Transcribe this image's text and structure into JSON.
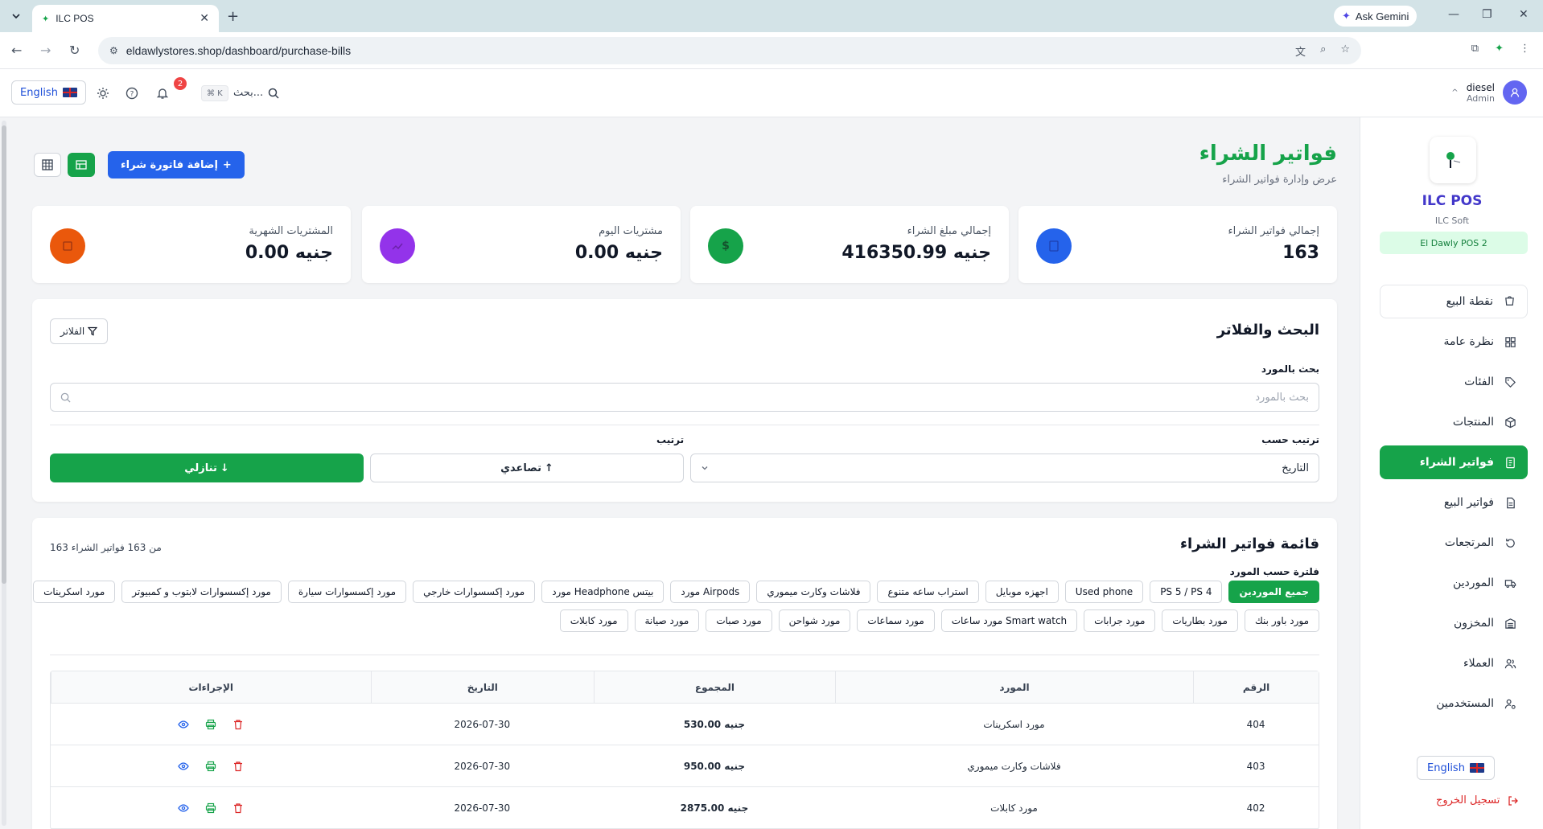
{
  "browser": {
    "tab_title": "ILC POS",
    "url": "eldawlystores.shop/dashboard/purchase-bills",
    "gemini_label": "Ask Gemini"
  },
  "header": {
    "lang_label": "English",
    "notif_count": "2",
    "kbd_hint": "⌘ K",
    "search_label": "بحث...",
    "user_name": "diesel",
    "user_role": "Admin"
  },
  "sidebar": {
    "brand": "ILC POS",
    "brand_sub": "ILC Soft",
    "badge": "El Dawly POS 2",
    "items": [
      {
        "label": "نقطة البيع",
        "icon": "cart-icon"
      },
      {
        "label": "نظرة عامة",
        "icon": "dashboard-icon"
      },
      {
        "label": "الفئات",
        "icon": "tag-icon"
      },
      {
        "label": "المنتجات",
        "icon": "box-icon"
      },
      {
        "label": "فواتير الشراء",
        "icon": "receipt-icon"
      },
      {
        "label": "فواتير البيع",
        "icon": "file-icon"
      },
      {
        "label": "المرتجعات",
        "icon": "rotate-icon"
      },
      {
        "label": "الموردين",
        "icon": "truck-icon"
      },
      {
        "label": "المخزون",
        "icon": "warehouse-icon"
      },
      {
        "label": "العملاء",
        "icon": "users-icon"
      },
      {
        "label": "المستخدمين",
        "icon": "user-cog-icon"
      }
    ],
    "lang_label": "English",
    "logout_label": "تسجيل الخروج"
  },
  "page": {
    "title": "فواتير الشراء",
    "subtitle": "عرض وإدارة فواتير الشراء",
    "add_button": "إضافة فاتورة شراء"
  },
  "stats": [
    {
      "label": "إجمالي فواتير الشراء",
      "value": "163",
      "color": "#2563eb"
    },
    {
      "label": "إجمالي مبلغ الشراء",
      "value": "416350.99 جنيه",
      "color": "#16a34a"
    },
    {
      "label": "مشتريات اليوم",
      "value": "0.00 جنيه",
      "color": "#9333ea"
    },
    {
      "label": "المشتريات الشهرية",
      "value": "0.00 جنيه",
      "color": "#ea580c"
    }
  ],
  "filters": {
    "title": "البحث والفلاتر",
    "filters_button": "الفلاتر",
    "supplier_label": "بحث بالمورد",
    "supplier_placeholder": "بحث بالمورد",
    "sort_by_label": "ترتيب حسب",
    "sort_by_value": "التاريخ",
    "order_label": "ترتيب",
    "asc_label": "تصاعدي",
    "desc_label": "تنازلي"
  },
  "list": {
    "title": "قائمة فواتير الشراء",
    "count_text": "163 من 163 فواتير الشراء",
    "filter_label": "فلترة حسب المورد",
    "chips_row1": [
      "جميع الموردين",
      "PS 5 / PS 4",
      "Used phone",
      "اجهزه موبايل",
      "استراب ساعه متنوع",
      "فلاشات وكارت ميموري",
      "مورد Airpods",
      "مورد Headphone بيتس",
      "مورد إكسسوارات خارجي",
      "مورد إكسسوارات سيارة",
      "مورد إكسسوارات لابتوب و كمبيوتر",
      "مورد اسكرينات"
    ],
    "chips_row2": [
      "مورد باور بنك",
      "مورد بطاريات",
      "مورد جرابات",
      "مورد ساعات Smart watch",
      "مورد سماعات",
      "مورد شواحن",
      "مورد صبات",
      "مورد صيانة",
      "مورد كابلات"
    ],
    "columns": [
      "الرقم",
      "المورد",
      "المجموع",
      "التاريخ",
      "الإجراءات"
    ],
    "rows": [
      {
        "id": "404",
        "supplier": "مورد اسكرينات",
        "total": "530.00 جنيه",
        "date": "2026-07-30"
      },
      {
        "id": "403",
        "supplier": "فلاشات وكارت ميموري",
        "total": "950.00 جنيه",
        "date": "2026-07-30"
      },
      {
        "id": "402",
        "supplier": "مورد كابلات",
        "total": "2875.00 جنيه",
        "date": "2026-07-30"
      }
    ]
  }
}
